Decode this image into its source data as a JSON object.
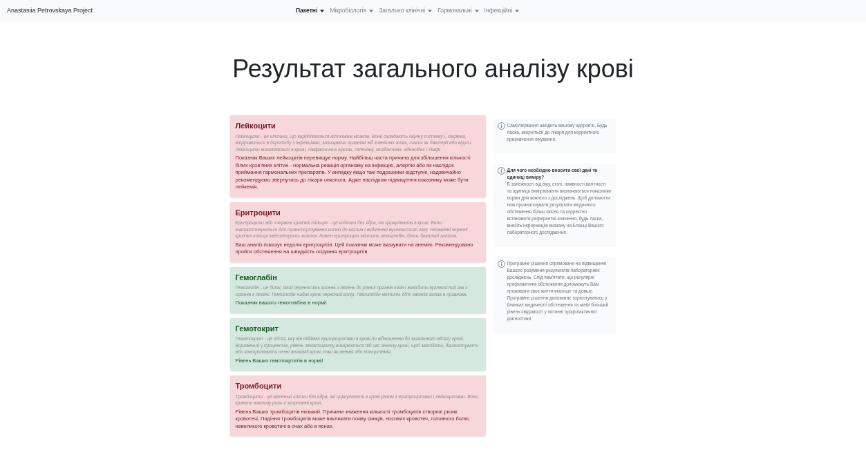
{
  "navbar": {
    "brand": "Anastasiia Petrovskaya Project",
    "menus": [
      {
        "label": "Пакетні",
        "selected": true
      },
      {
        "label": "Мікробіологія",
        "selected": false
      },
      {
        "label": "Загально клінічні",
        "selected": false
      },
      {
        "label": "Гормональні",
        "selected": false
      },
      {
        "label": "Інфекційні",
        "selected": false
      }
    ]
  },
  "title": "Результат загального аналізу крові",
  "results": [
    {
      "name": "Лейкоцити",
      "normal": false,
      "description": "Лейкоцити - це клітини, що виробляються кістковим мозком. Вони складають імунну систему і, зокрема, втручаються в боротьбу з інфекціями, захищаючи організм від зовнішніх атак, таких як бактерії або віруси. Лейкоцити виявляються в крові, лімфатичних вузлах, селезінці, мигдалинах, аденоїдах і лімфі.",
      "verdict": "Показник Ваших лейкоцитів перевищує норму. Найбільш часта причина для збільшення кількості білих кров'яних клітин - нормальна реакція організму на інфекцію, алергію або як наслідок приймання гармональних препаратів. У випадку якщо такі подразники відступні, надзвичайно рекомендуємо звернутись до лікаря онколога. Адже наслідком підвищення показнику може бути лейкемія."
    },
    {
      "name": "Еритроцити",
      "normal": false,
      "description": "Еритроцити або «червоні кров'яні тільця» - це клітини без ядра, які циркулюють в крові. Вони використовуються для транспортування кисню до клітин і виділення вуглекислого газу. Незамінні червоні кров'яні тільця забезпечують життя. Кожен еритроцит містить гемоглобін, білок, багатий залізом.",
      "verdict": "Ваш аналіз показує недолік еритроцитів. Цей показник може вказувати на анемію. Рекомендовано пройти обстеження на швидкість осідання еритроцитів."
    },
    {
      "name": "Гемоглабін",
      "normal": true,
      "description": "Гемоглобін - це білок, який переносить кисень з легень до різних органів тіла і виводить вуглекислий газ з органів в легені. Гемоглобін надає крові червоний колір. Гемоглобін містить 65% запасів заліза в організмі.",
      "verdict": "Показник вашого гемоглабіна в нормі!"
    },
    {
      "name": "Гемотокрит",
      "normal": true,
      "description": "Гематокрит - це обсяг, яку він обіймає еритроцитами в крові по відношенню до загального обсягу крові. Виражений у процентах, рівень гематокриту вимірюється під час аналізу крові, щоб запобігти, діагностувати або контролювати певні аномалії крові, такі як анемія або поліцитемія.",
      "verdict": "Рівень Ваших гемотокртитів в нормі!"
    },
    {
      "name": "Тромбоцити",
      "normal": false,
      "description": "Тромбоцити - це маленькі клітки без ядра, які циркулюють в крові разом з еритроцитами і лейкоцитами. Вони грають важливу роль в згортанні крові.",
      "verdict": "Рівень Ваших тромбоцитів низький. Причини зниження кількості тромбоцитів створює ризик кровотечі. Падіння тромбоцитів може викликати появу синців, носових кровотеч, головного болю, невеликого кровотечі в очах або в яснах."
    }
  ],
  "notes": [
    {
      "text": "Самолікування шкодить вашому здоров'ю. Будь ласка, зверніться до лікаря для корректного призначення лікування."
    },
    {
      "heading": "Для чого необхідно вносити свої дані та одиниці виміру?",
      "text": "В залежності від віку, статі, наявності вагітності та одиниць вимірювання визначаються показники норми для кожного з досліджень. Щоб допомогти нам проаналізувати результати медичного обстеження більш якісно та корректно встановити референтні значення, будь ласка, внесіть інформацію вказану на Бланці Вашого лабораторного дослідження."
    },
    {
      "text": "Програмне рішення спрямоване на підвищення Вашого розуміння результатів лабораторних досліджень. Слід пам'ятати, що регулярні профілактичні обстеження допоможуть Вам проживати своє життя якісніше та довше. Програмне рішення допомагає зорієнтуватись у бланках медичного обстеження та мати більший рівень свідомості у питанні профілактичної діагностики."
    }
  ]
}
